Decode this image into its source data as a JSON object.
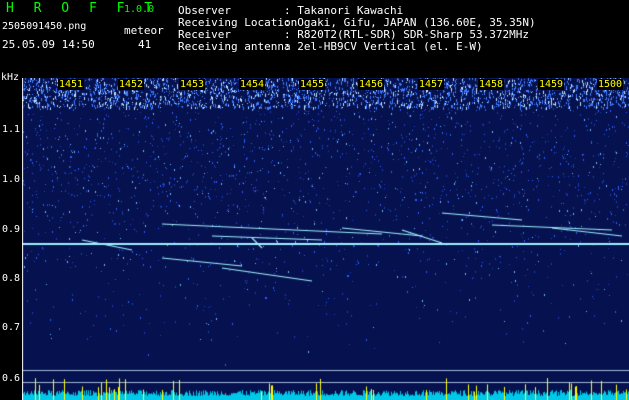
{
  "header": {
    "app_name": "H R O F F T",
    "version": "1.0.0",
    "filename": "2505091450.png",
    "timestamp": "25.05.09 14:50",
    "meteor_label": "meteor",
    "meteor_count": "41",
    "info": [
      {
        "key": "Observer",
        "value": ": Takanori Kawachi"
      },
      {
        "key": "Receiving Location",
        "value": ": Ogaki, Gifu, JAPAN (136.60E, 35.35N)"
      },
      {
        "key": "Receiver",
        "value": ": R820T2(RTL-SDR) SDR-Sharp 53.372MHz"
      },
      {
        "key": "Receiving antenna",
        "value": ": 2el-HB9CV Vertical (el. E-W)"
      }
    ]
  },
  "spectrogram": {
    "unit_label": "kHz",
    "y_ticks": [
      "1.1",
      "1.0",
      "0.9",
      "0.8",
      "0.7",
      "0.6"
    ],
    "x_ticks": [
      "1451",
      "1452",
      "1453",
      "1454",
      "1455",
      "1456",
      "1457",
      "1458",
      "1459",
      "1500"
    ],
    "colors": {
      "background": "#0a1a6e",
      "noise": "#2a5cff",
      "trace": "#9ff0ff",
      "axis": "#ffffff",
      "minute_label": "#ffff00",
      "level_bar": "#ffff00"
    }
  }
}
